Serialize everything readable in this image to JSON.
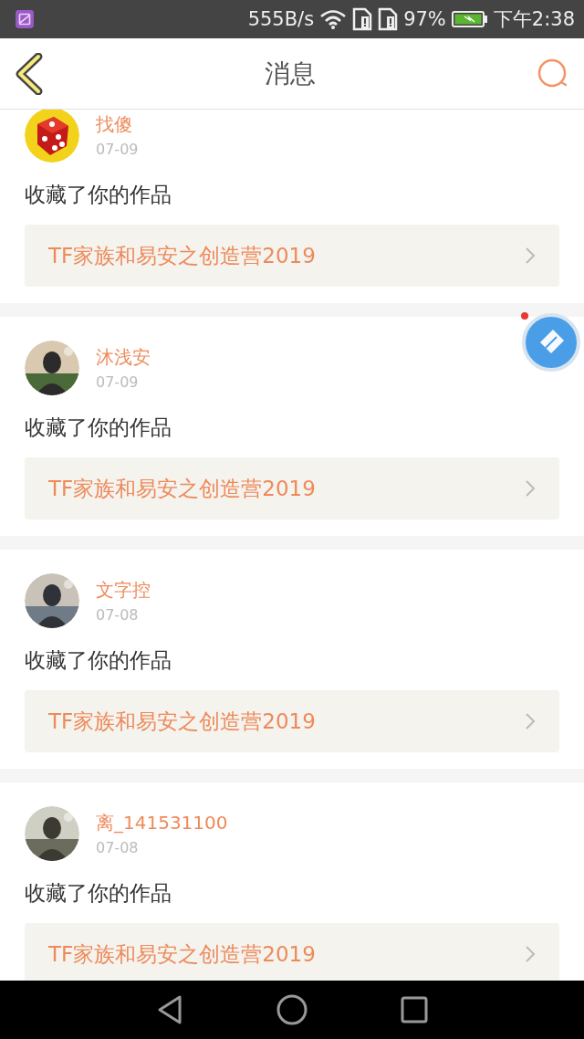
{
  "status_bar": {
    "speed": "555B/s",
    "battery": "97%",
    "time": "下午2:38"
  },
  "header": {
    "title": "消息"
  },
  "messages": [
    {
      "name": "找傻",
      "date": "07-09",
      "action": "收藏了你的作品",
      "work": "TF家族和易安之创造营2019",
      "kind": "dice"
    },
    {
      "name": "沐浅安",
      "date": "07-09",
      "action": "收藏了你的作品",
      "work": "TF家族和易安之创造营2019",
      "kind": "picture"
    },
    {
      "name": "文字控",
      "date": "07-08",
      "action": "收藏了你的作品",
      "work": "TF家族和易安之创造营2019",
      "kind": "picture"
    },
    {
      "name": "离_141531100",
      "date": "07-08",
      "action": "收藏了你的作品",
      "work": "TF家族和易安之创造营2019",
      "kind": "picture"
    }
  ],
  "floating_button": {
    "notification": true
  }
}
